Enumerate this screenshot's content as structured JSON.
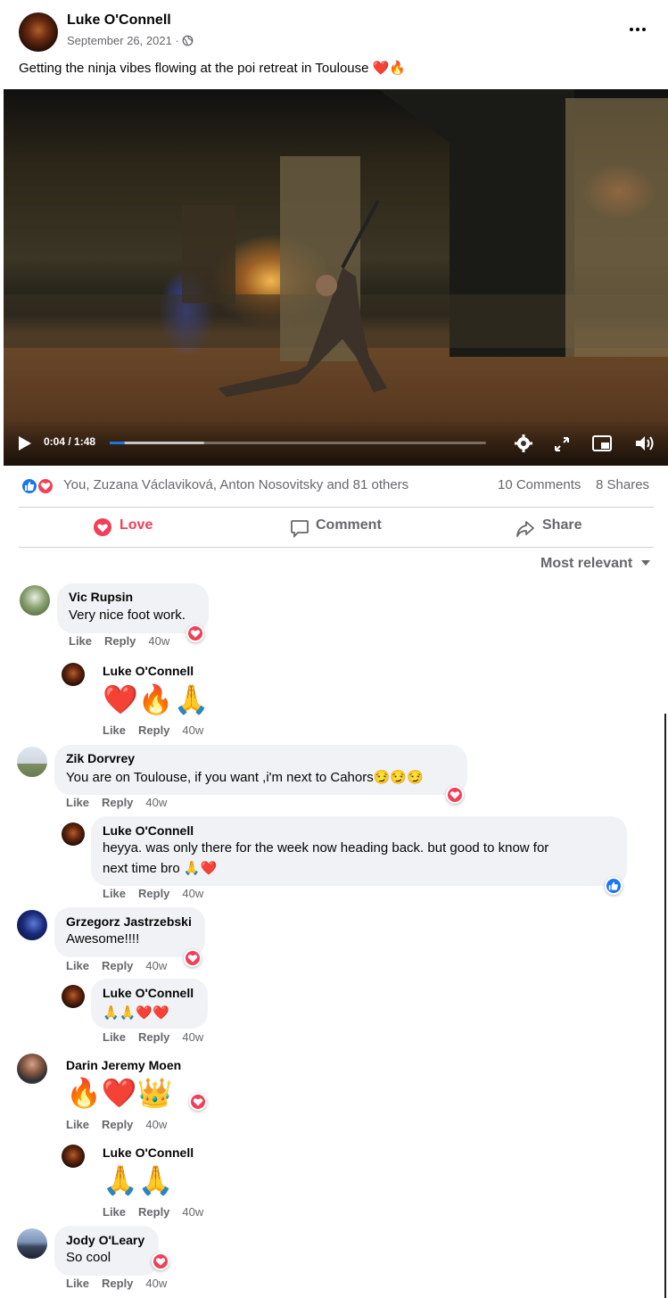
{
  "post": {
    "author": "Luke O'Connell",
    "date": "September 26, 2021",
    "date_separator": "·",
    "text": "Getting the ninja vibes flowing at the poi retreat in Toulouse",
    "text_emojis": "❤️🔥",
    "menu_icon": "more-dots-icon",
    "audience_icon": "globe-icon"
  },
  "video": {
    "time": "0:04 / 1:48",
    "progress": 0.04,
    "buffered": 0.25,
    "controls": [
      "play-icon",
      "settings-icon",
      "fullscreen-icon",
      "pip-icon",
      "volume-icon"
    ]
  },
  "stats": {
    "reactions_text": "You, Zuzana Václaviková, Anton Nosovitsky and 81 others",
    "comments": "10 Comments",
    "shares": "8 Shares"
  },
  "actions": {
    "love": "Love",
    "comment": "Comment",
    "share": "Share"
  },
  "sort": {
    "label": "Most relevant"
  },
  "comments": [
    {
      "author": "Vic Rupsin",
      "text": "Very nice foot work.",
      "like": "Like",
      "reply": "Reply",
      "age": "40w"
    },
    {
      "author": "Luke O'Connell",
      "emojis": "❤️🔥🙏",
      "like": "Like",
      "reply": "Reply",
      "age": "40w"
    },
    {
      "author": "Zik Dorvrey",
      "text": "You are on Toulouse, if you want ,i'm next to Cahors",
      "text_emojis": "😏😏😏",
      "like": "Like",
      "reply": "Reply",
      "age": "40w"
    },
    {
      "author": "Luke O'Connell",
      "text_line1": "heyya. was only there for the week now heading back. but good to know for",
      "text_line2": "next time bro",
      "text_emojis": "🙏❤️",
      "like": "Like",
      "reply": "Reply",
      "age": "40w"
    },
    {
      "author": "Grzegorz Jastrzebski",
      "text": "Awesome!!!!",
      "like": "Like",
      "reply": "Reply",
      "age": "40w"
    },
    {
      "author": "Luke O'Connell",
      "text_emojis": "🙏🙏❤️❤️",
      "like": "Like",
      "reply": "Reply",
      "age": "40w"
    },
    {
      "author": "Darin Jeremy Moen",
      "emojis": "🔥❤️👑",
      "like": "Like",
      "reply": "Reply",
      "age": "40w"
    },
    {
      "author": "Luke O'Connell",
      "emojis": "🙏🙏",
      "like": "Like",
      "reply": "Reply",
      "age": "40w"
    },
    {
      "author": "Jody O'Leary",
      "text": "So cool",
      "like": "Like",
      "reply": "Reply",
      "age": "40w"
    }
  ],
  "colors": {
    "love": "#f33e58",
    "like": "#1877f2",
    "secondary_text": "#65676b",
    "bubble": "#f0f2f5"
  }
}
